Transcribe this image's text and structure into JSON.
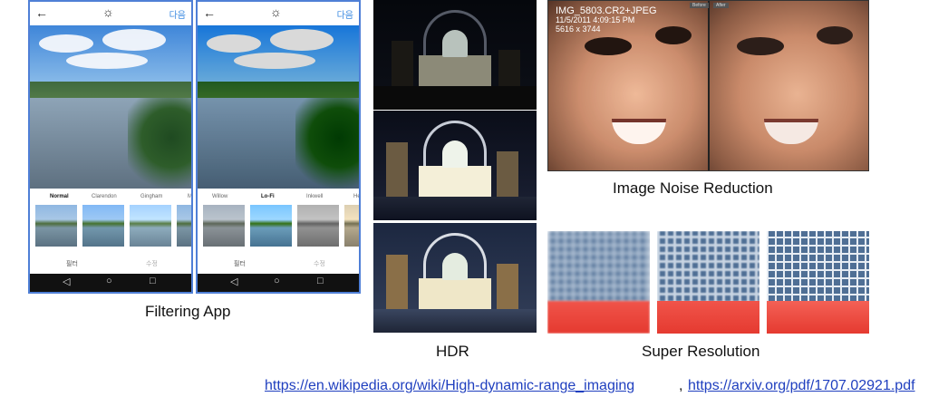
{
  "phones": [
    {
      "back_icon": "←",
      "brightness_icon": "☼",
      "next_label": "다음",
      "filters": [
        "Normal",
        "Clarendon",
        "Gingham",
        "M"
      ],
      "selected_filter": "Normal",
      "bottom_tabs": [
        "필터",
        "수정"
      ],
      "nav_icons": [
        "◁",
        "○",
        "□"
      ]
    },
    {
      "back_icon": "←",
      "brightness_icon": "☼",
      "next_label": "다음",
      "filters": [
        "Willow",
        "Lo-Fi",
        "Inkwell",
        "He"
      ],
      "selected_filter": "Lo-Fi",
      "bottom_tabs": [
        "필터",
        "수정"
      ],
      "nav_icons": [
        "◁",
        "○",
        "□"
      ]
    }
  ],
  "captions": {
    "filtering_app": "Filtering App",
    "hdr": "HDR",
    "noise_reduction": "Image Noise Reduction",
    "super_resolution": "Super Resolution"
  },
  "noise_panel": {
    "filename": "IMG_5803.CR2+JPEG",
    "datetime": "11/5/2011 4:09:15 PM",
    "dimensions": "5616 x 3744",
    "before_tag": "Before",
    "after_tag": "After"
  },
  "links": {
    "hdr_url": "https://en.wikipedia.org/wiki/High-dynamic-range_imaging",
    "separator": ",",
    "arxiv_url": "https://arxiv.org/pdf/1707.02921.pdf"
  }
}
